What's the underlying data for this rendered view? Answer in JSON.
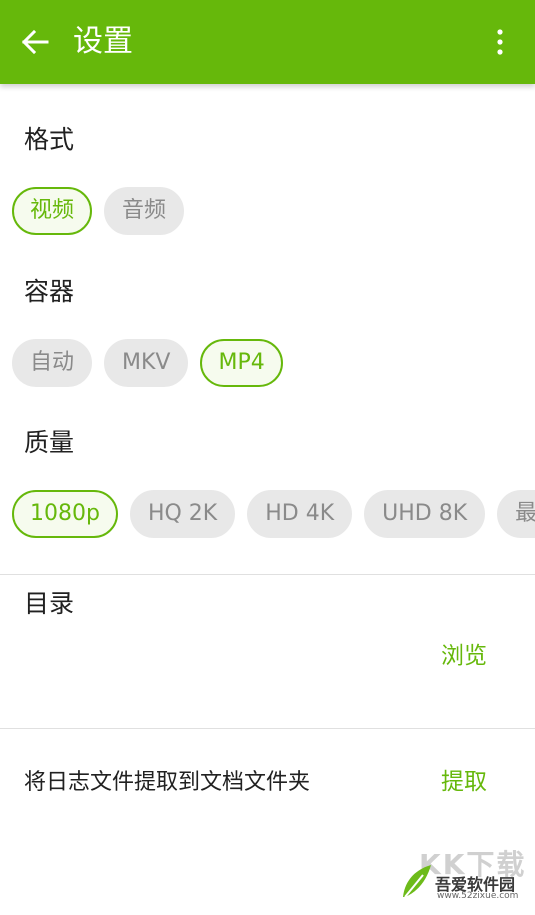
{
  "header": {
    "title": "设置",
    "back_icon": "arrow-left-icon",
    "menu_icon": "more-vertical-icon",
    "color": "#66b80b"
  },
  "format": {
    "title": "格式",
    "options": [
      {
        "label": "视频",
        "selected": true
      },
      {
        "label": "音频",
        "selected": false
      }
    ]
  },
  "container": {
    "title": "容器",
    "options": [
      {
        "label": "自动",
        "selected": false
      },
      {
        "label": "MKV",
        "selected": false
      },
      {
        "label": "MP4",
        "selected": true
      }
    ]
  },
  "quality": {
    "title": "质量",
    "options": [
      {
        "label": "1080p",
        "selected": true
      },
      {
        "label": "HQ 2K",
        "selected": false
      },
      {
        "label": "HD 4K",
        "selected": false
      },
      {
        "label": "UHD 8K",
        "selected": false
      },
      {
        "label": "最好",
        "selected": false
      }
    ]
  },
  "directory": {
    "title": "目录",
    "action": "浏览"
  },
  "log": {
    "label": "将日志文件提取到文档文件夹",
    "action": "提取"
  },
  "watermark": {
    "logo_text": "KK下载",
    "site_name": "吾爱软件园",
    "url": "www.52zixue.com"
  }
}
